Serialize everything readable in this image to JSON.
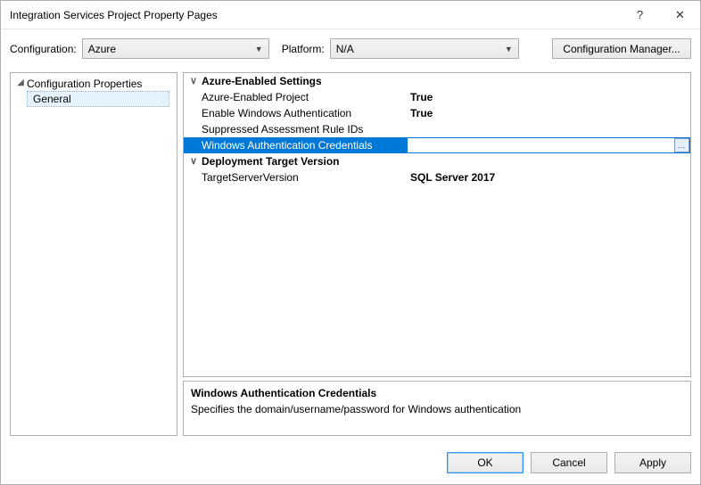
{
  "titlebar": {
    "title": "Integration Services Project Property Pages",
    "help": "?",
    "close": "✕"
  },
  "configRow": {
    "configLabel": "Configuration:",
    "configValue": "Azure",
    "platformLabel": "Platform:",
    "platformValue": "N/A",
    "managerBtn": "Configuration Manager..."
  },
  "tree": {
    "rootLabel": "Configuration Properties",
    "childLabel": "General"
  },
  "grid": {
    "cat1": "Azure-Enabled Settings",
    "rows1": [
      {
        "name": "Azure-Enabled Project",
        "value": "True",
        "bold": true
      },
      {
        "name": "Enable Windows Authentication",
        "value": "True",
        "bold": true
      },
      {
        "name": "Suppressed Assessment Rule IDs",
        "value": "",
        "bold": false
      },
      {
        "name": "Windows Authentication Credentials",
        "value": "",
        "bold": false,
        "selected": true
      }
    ],
    "cat2": "Deployment Target Version",
    "rows2": [
      {
        "name": "TargetServerVersion",
        "value": "SQL Server 2017",
        "bold": true
      }
    ]
  },
  "desc": {
    "title": "Windows Authentication Credentials",
    "body": "Specifies the domain/username/password for Windows authentication"
  },
  "footer": {
    "ok": "OK",
    "cancel": "Cancel",
    "apply": "Apply"
  }
}
